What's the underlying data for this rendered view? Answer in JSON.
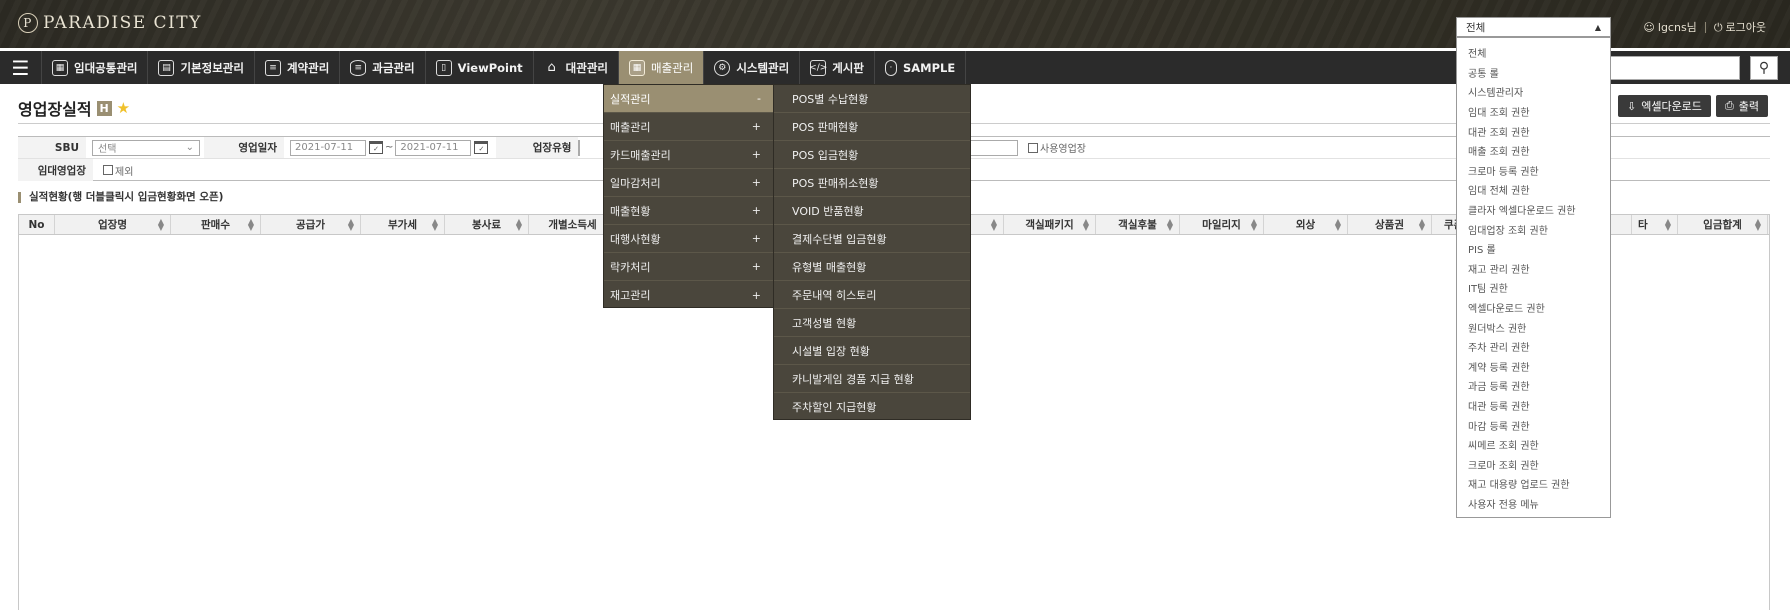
{
  "header": {
    "logo_text": "PARADISE CITY",
    "user_name": "lgcns님",
    "logout_label": "로그아웃"
  },
  "nav": {
    "items": [
      {
        "label": "임대공통관리",
        "icon": "building-icon"
      },
      {
        "label": "기본정보관리",
        "icon": "id-card-icon"
      },
      {
        "label": "계약관리",
        "icon": "document-icon"
      },
      {
        "label": "과금관리",
        "icon": "database-icon"
      },
      {
        "label": "ViewPoint",
        "icon": "view-icon"
      },
      {
        "label": "대관관리",
        "icon": "home-icon"
      },
      {
        "label": "매출관리",
        "icon": "grid-icon"
      },
      {
        "label": "시스템관리",
        "icon": "gear-icon"
      },
      {
        "label": "게시판",
        "icon": "code-icon"
      },
      {
        "label": "SAMPLE",
        "icon": "mouse-icon"
      }
    ]
  },
  "page": {
    "title": "영업장실적",
    "badge": "H",
    "excel_label": "엑셀다운로드",
    "print_label": "출력"
  },
  "filters": {
    "sbu_label": "SBU",
    "sbu_value": "선택",
    "date_label": "영업일자",
    "date_from": "2021-07-11",
    "date_to": "2021-07-11",
    "date_sep": "~",
    "biz_type_label": "업장유형",
    "use_store_label": "사용영업장",
    "rent_store_label": "임대영업장",
    "exclude_label": "제외"
  },
  "table": {
    "section_title": "실적현황(행 더블클릭시 입금현황화면 오픈)",
    "columns_left": [
      "No",
      "업장명",
      "판매수",
      "공급가",
      "부가세",
      "봉사료",
      "개별소득세"
    ],
    "columns_right": [
      "객실패키지",
      "객실후불",
      "마일리지",
      "외상",
      "상품권",
      "쿠폰"
    ],
    "columns_end": [
      "타",
      "입금합계"
    ]
  },
  "sales_menu": {
    "items": [
      {
        "label": "실적관리",
        "mark": "-"
      },
      {
        "label": "매출관리",
        "mark": "+"
      },
      {
        "label": "카드매출관리",
        "mark": "+"
      },
      {
        "label": "일마감처리",
        "mark": "+"
      },
      {
        "label": "매출현황",
        "mark": "+"
      },
      {
        "label": "대행사현황",
        "mark": "+"
      },
      {
        "label": "락카처리",
        "mark": "+"
      },
      {
        "label": "재고관리",
        "mark": "+"
      }
    ],
    "submenu": [
      "POS별 수납현황",
      "POS 판매현황",
      "POS 입금현황",
      "POS 판매취소현황",
      "VOID 반품현황",
      "결제수단별 입금현황",
      "유형별 매출현황",
      "주문내역 히스토리",
      "고객성별 현황",
      "시설별 입장 현황",
      "카니발게임 경품 지급 현황",
      "주차할인 지급현황"
    ]
  },
  "role_dropdown": {
    "selected": "전체",
    "options": [
      "전체",
      "공통 롤",
      "시스템관리자",
      "임대 조회 권한",
      "대관 조회 권한",
      "매출 조회 권한",
      "크로마 등록 권한",
      "임대 전체 권한",
      "클라자 엑셀다운로드 권한",
      "임대업장 조회 권한",
      "PIS 롤",
      "재고 관리 권한",
      "IT팀 권한",
      "엑셀다운로드 권한",
      "원더박스 권한",
      "주차 관리 권한",
      "계약 등록 권한",
      "과금 등록 권한",
      "대관 등록 권한",
      "마감 등록 권한",
      "씨메르 조회 권한",
      "크로마 조회 권한",
      "재고 대용량 업로드 권한",
      "사용자 전용 메뉴"
    ]
  },
  "colors": {
    "accent": "#9a8f72",
    "nav_bg": "#2b2b2b",
    "menu_bg": "#4a463c"
  }
}
